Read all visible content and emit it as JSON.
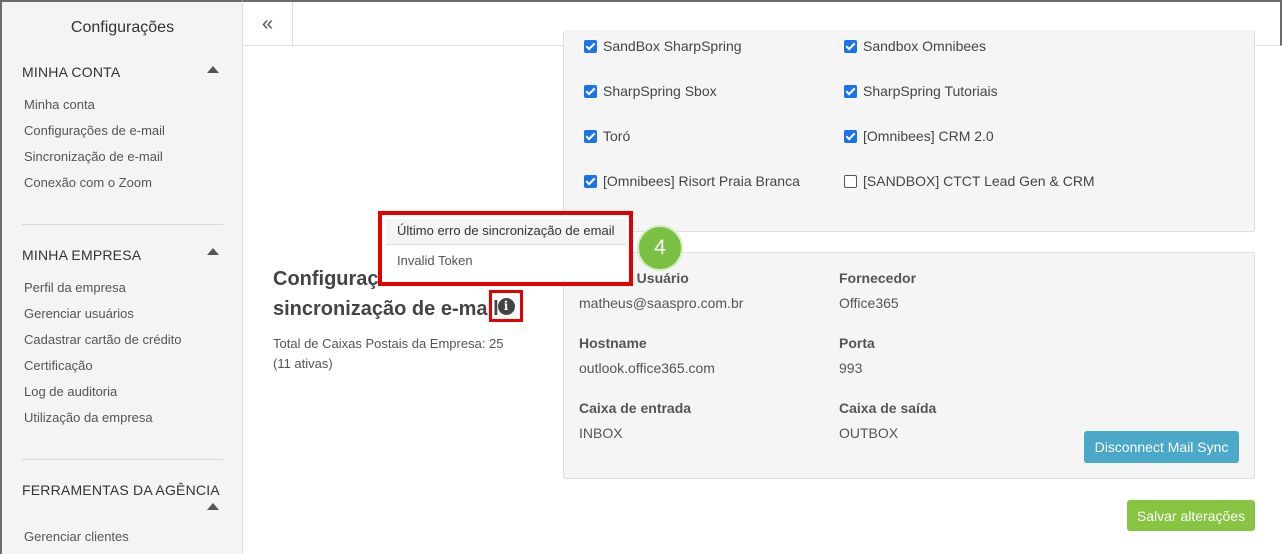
{
  "sidebar": {
    "title": "Configurações",
    "sections": [
      {
        "label": "MINHA CONTA",
        "items": [
          "Minha conta",
          "Configurações de e-mail",
          "Sincronização de e-mail",
          "Conexão com o Zoom"
        ]
      },
      {
        "label": "MINHA EMPRESA",
        "items": [
          "Perfil da empresa",
          "Gerenciar usuários",
          "Cadastrar cartão de crédito",
          "Certificação",
          "Log de auditoria",
          "Utilização da empresa"
        ]
      },
      {
        "label": "FERRAMENTAS DA AGÊNCIA",
        "items": [
          "Gerenciar clientes"
        ]
      }
    ]
  },
  "topbar": {
    "collapse_glyph": "«"
  },
  "accounts": [
    {
      "label": "SandBox SharpSpring",
      "checked": true
    },
    {
      "label": "Sandbox Omnibees",
      "checked": true
    },
    {
      "label": "SharpSpring Sbox",
      "checked": true
    },
    {
      "label": "SharpSpring Tutoriais",
      "checked": true
    },
    {
      "label": "Toró",
      "checked": true
    },
    {
      "label": "[Omnibees] CRM 2.0",
      "checked": true
    },
    {
      "label": "[Omnibees] Risort Praia Branca",
      "checked": true
    },
    {
      "label": "[SANDBOX] CTCT Lead Gen & CRM",
      "checked": false
    }
  ],
  "sync": {
    "title_line1": "Configuraç",
    "title_line2": "sincronização de e-mail",
    "total_line1": "Total de Caixas Postais da Empresa: 25",
    "total_line2": "(11 ativas)",
    "info_glyph": "i",
    "fields": {
      "user_label": "e Usuário",
      "user_value": "matheus@saaspro.com.br",
      "provider_label": "Fornecedor",
      "provider_value": "Office365",
      "hostname_label": "Hostname",
      "hostname_value": "outlook.office365.com",
      "port_label": "Porta",
      "port_value": "993",
      "inbox_label": "Caixa de entrada",
      "inbox_value": "INBOX",
      "outbox_label": "Caixa de saída",
      "outbox_value": "OUTBOX"
    },
    "disconnect_label": "Disconnect Mail Sync"
  },
  "tooltip": {
    "title": "Último erro de sincronização de email",
    "message": "Invalid Token"
  },
  "step_badge": "4",
  "save_label": "Salvar alterações",
  "colors": {
    "checkbox": "#1a73e8",
    "disconnect": "#4aa8c8",
    "save": "#86c442",
    "badge": "#7bc043",
    "highlight": "#e30000"
  }
}
